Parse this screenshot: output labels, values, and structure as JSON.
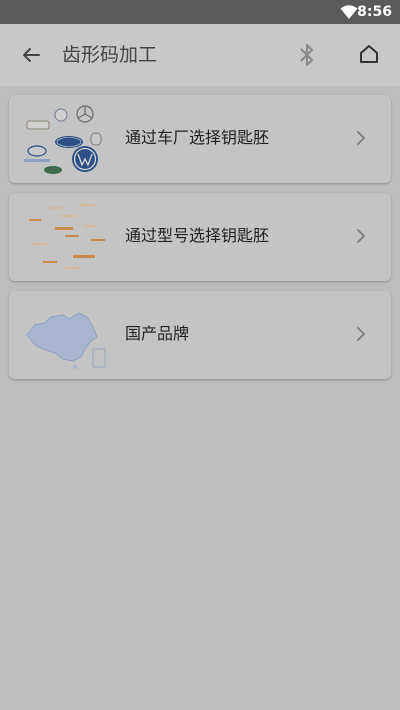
{
  "status_bar": {
    "time": "8:56"
  },
  "app_bar": {
    "title": "齿形码加工"
  },
  "menu": {
    "items": [
      {
        "label": "通过车厂选择钥匙胚"
      },
      {
        "label": "通过型号选择钥匙胚"
      },
      {
        "label": "国产品牌"
      }
    ]
  },
  "colors": {
    "background": "#bdbdbd",
    "card": "#c4c4c4",
    "status_bar": "#5a5a5a",
    "accent_text": "#c98a4a"
  }
}
